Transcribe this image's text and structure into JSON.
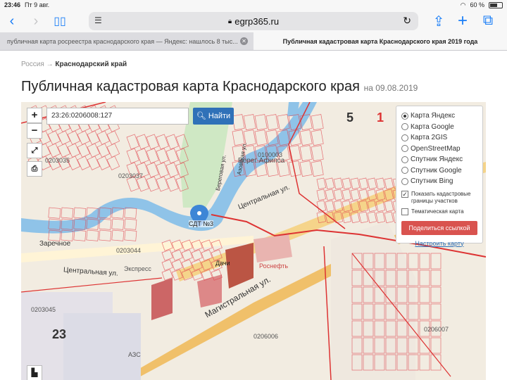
{
  "status": {
    "time": "23:46",
    "date": "Пт 9 авг.",
    "battery": "60 %",
    "battery_level": 0.6
  },
  "browser": {
    "url": "egrp365.ru",
    "tabs": [
      {
        "title": "публичная карта росреестра краснодарского края — Яндекс: нашлось 8 тыс..."
      },
      {
        "title": "Публичная кадастровая карта Краснодарского края 2019 года"
      }
    ],
    "icons": {
      "back": "chevron-left-icon",
      "forward": "chevron-right-icon",
      "bookmarks": "book-icon",
      "reader": "text-icon",
      "lock": "lock-icon",
      "reload": "reload-icon",
      "share": "share-icon",
      "add": "plus-icon",
      "tabs": "tabs-icon"
    }
  },
  "breadcrumb": {
    "root": "Россия",
    "arrow": "→",
    "current": "Краснодарский край"
  },
  "page": {
    "title": "Публичная кадастровая карта Краснодарского края",
    "date_prefix": "на",
    "date": "09.08.2019"
  },
  "map": {
    "search_value": "23:26:0206008:127",
    "search_button": "Найти",
    "zoom_in": "+",
    "zoom_out": "−",
    "marker_label": "СДТ №3",
    "layers": [
      {
        "label": "Карта Яндекс",
        "selected": true
      },
      {
        "label": "Карта Google",
        "selected": false
      },
      {
        "label": "Карта 2GIS",
        "selected": false
      },
      {
        "label": "OpenStreetMap",
        "selected": false
      },
      {
        "label": "Спутник Яндекс",
        "selected": false
      },
      {
        "label": "Спутник Google",
        "selected": false
      },
      {
        "label": "Спутник Bing",
        "selected": false
      }
    ],
    "show_borders": {
      "label": "Показать кадастровые границы участков",
      "checked": true
    },
    "thematic": {
      "label": "Тематическая карта",
      "checked": false
    },
    "share_button": "Поделиться ссылкой",
    "setup_link": "Настроить карту",
    "labels": {
      "c1": "0203035",
      "c2": "0203037",
      "c3": "0203044",
      "c4": "0203045",
      "c5": "0206006",
      "c6": "0206007",
      "c7": "0100003",
      "q1": "5",
      "q2": "1",
      "q3": "23",
      "bereg": "Берег Афипса",
      "zarechnoe": "Заречное",
      "rosneft": "Роснефть",
      "dachi": "Дачи",
      "azs": "АЗС",
      "express": "Экспресс",
      "st_central": "Центральная ул.",
      "st_central2": "Центральная ул.",
      "st_magistral": "Магистральная ул.",
      "st_beregovaya": "Береговая ул.",
      "st_azovskaya": "Азовская ул."
    },
    "colors": {
      "boundary": "#e0434c",
      "water": "#8fc3e8",
      "road": "#f0c06a",
      "land": "#f2ece1"
    }
  }
}
